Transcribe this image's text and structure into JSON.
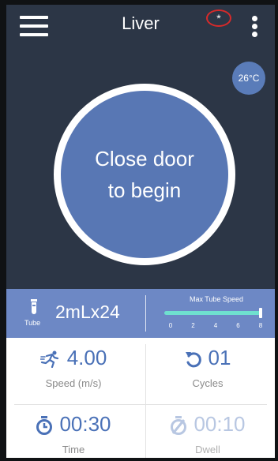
{
  "header": {
    "title": "Liver",
    "status_mark": "*"
  },
  "temperature": "26°C",
  "door_message": {
    "line1": "Close door",
    "line2": "to begin"
  },
  "tube": {
    "label": "Tube",
    "size": "2mLx24",
    "speed_title": "Max Tube Speed",
    "slider_ticks": [
      "0",
      "2",
      "4",
      "6",
      "8"
    ],
    "slider_min": 0,
    "slider_max": 8,
    "slider_value": 8
  },
  "settings": {
    "speed": {
      "value": "4.00",
      "label": "Speed (m/s)",
      "icon": "runner-icon"
    },
    "cycles": {
      "value": "01",
      "label": "Cycles",
      "icon": "repeat-icon"
    },
    "time": {
      "value": "00:30",
      "label": "Time",
      "icon": "timer-icon"
    },
    "dwell": {
      "value": "00:10",
      "label": "Dwell",
      "icon": "disabled-timer-icon"
    }
  },
  "colors": {
    "background": "#2c3646",
    "accent": "#5877b4",
    "slider": "#6fe0cf",
    "status_ring": "#d72a2a"
  }
}
